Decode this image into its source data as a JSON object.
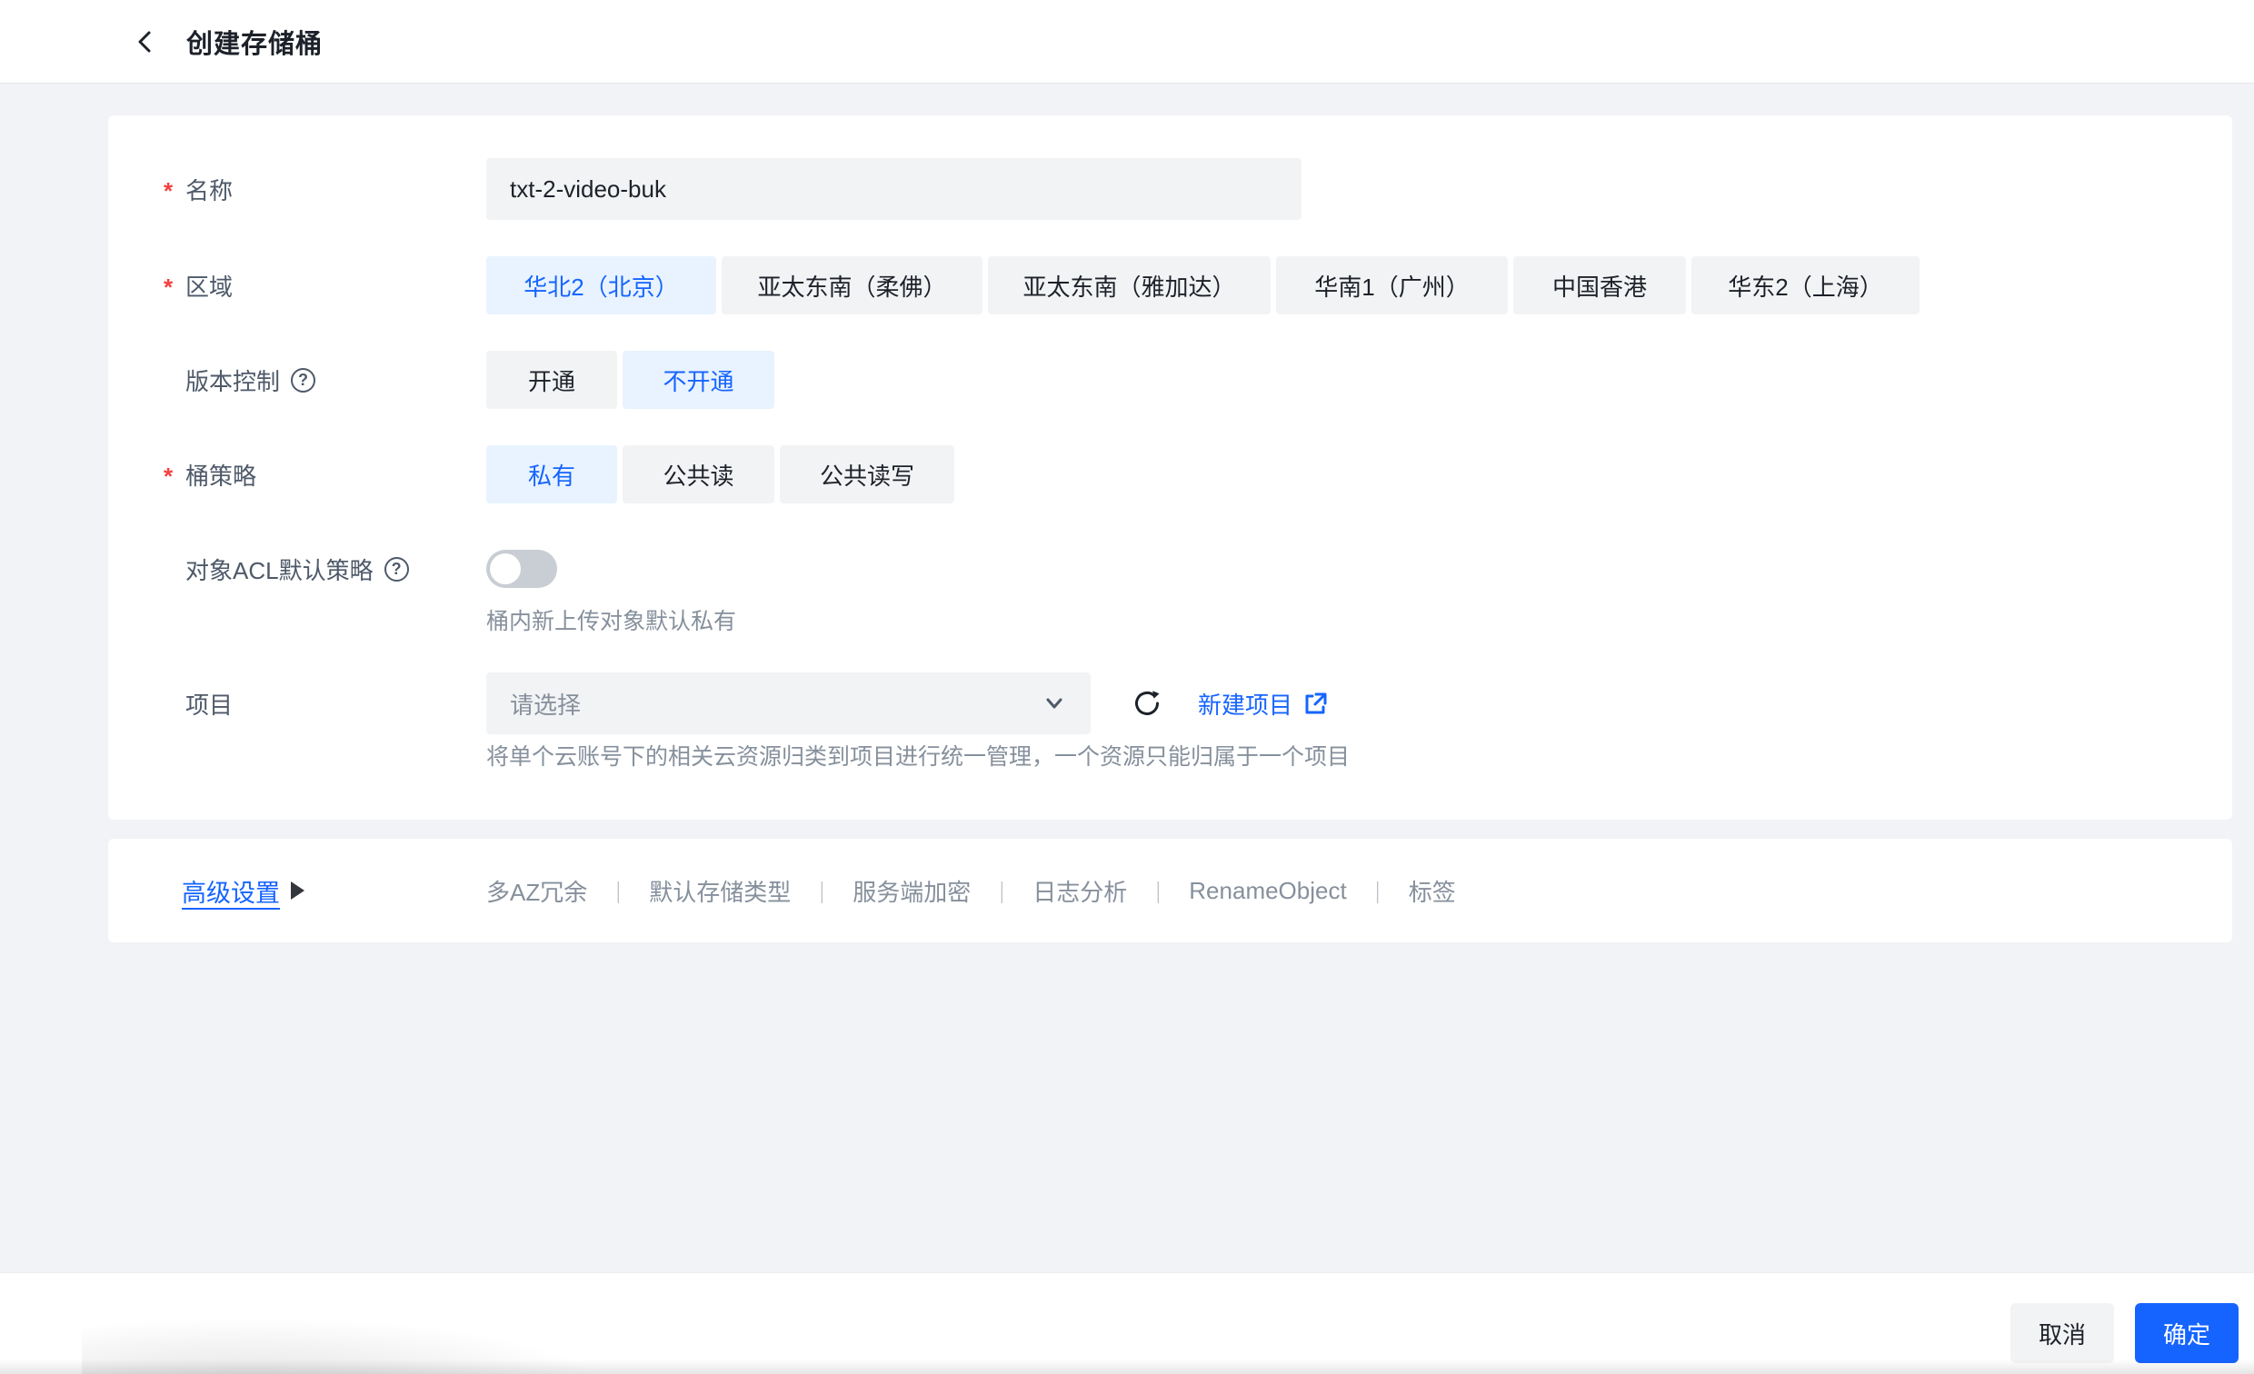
{
  "header": {
    "title": "创建存储桶"
  },
  "form": {
    "name": {
      "label": "名称",
      "required": true,
      "value": "txt-2-video-buk"
    },
    "region": {
      "label": "区域",
      "required": true,
      "options": [
        "华北2（北京）",
        "亚太东南（柔佛）",
        "亚太东南（雅加达）",
        "华南1（广州）",
        "中国香港",
        "华东2（上海）"
      ],
      "selected": "华北2（北京）"
    },
    "versioning": {
      "label": "版本控制",
      "options": [
        "开通",
        "不开通"
      ],
      "selected": "不开通"
    },
    "policy": {
      "label": "桶策略",
      "required": true,
      "options": [
        "私有",
        "公共读",
        "公共读写"
      ],
      "selected": "私有"
    },
    "acl": {
      "label": "对象ACL默认策略",
      "toggle_on": false,
      "caption": "桶内新上传对象默认私有"
    },
    "project": {
      "label": "项目",
      "placeholder": "请选择",
      "new_project_link": "新建项目",
      "help": "将单个云账号下的相关云资源归类到项目进行统一管理，一个资源只能归属于一个项目"
    }
  },
  "advanced": {
    "label": "高级设置",
    "features": [
      "多AZ冗余",
      "默认存储类型",
      "服务端加密",
      "日志分析",
      "RenameObject",
      "标签"
    ],
    "separator": "｜"
  },
  "footer": {
    "cancel_label": "取消",
    "confirm_label": "确定"
  },
  "colors": {
    "accent": "#1664ff",
    "accent_light_bg": "#e8f3ff",
    "danger": "#f53f3f",
    "neutral_bg": "#f2f3f5",
    "muted_text": "#86909c"
  }
}
